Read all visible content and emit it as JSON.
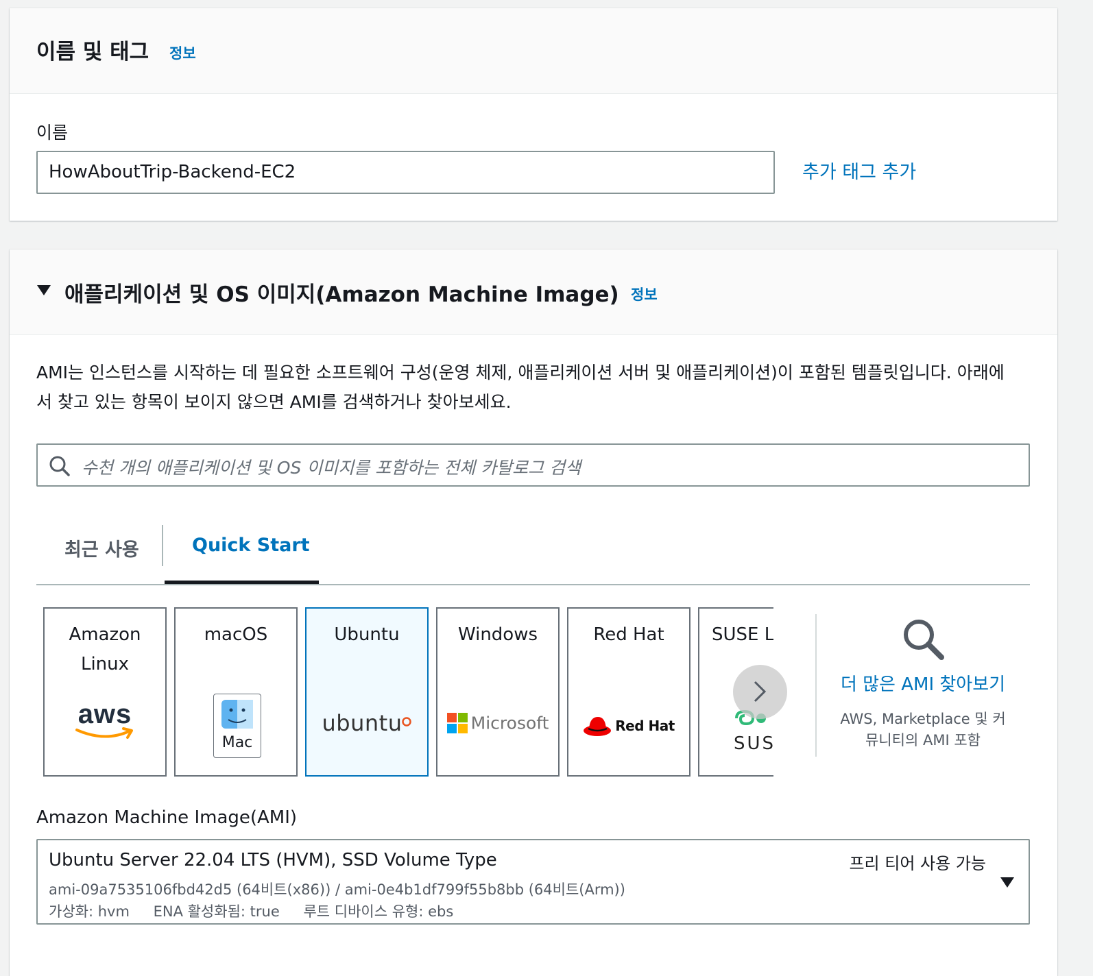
{
  "name_panel": {
    "title": "이름 및 태그",
    "info": "정보",
    "name_label": "이름",
    "name_value": "HowAboutTrip-Backend-EC2",
    "add_tags": "추가 태그 추가"
  },
  "ami_panel": {
    "title": "애플리케이션 및 OS 이미지(Amazon Machine Image)",
    "info": "정보",
    "description_line1": "AMI는 인스턴스를 시작하는 데 필요한 소프트웨어 구성(운영 체제, 애플리케이션 서버 및 애플리케이션)이 포함된 템플릿입니다. 아래에",
    "description_line2": "서 찾고 있는 항목이 보이지 않으면 AMI를 검색하거나 찾아보세요.",
    "search_placeholder": "수천 개의 애플리케이션 및 OS 이미지를 포함하는 전체 카탈로그 검색",
    "tabs": [
      {
        "label": "최근 사용",
        "active": false
      },
      {
        "label": "Quick Start",
        "active": true
      }
    ],
    "os_tiles": [
      {
        "title_line1": "Amazon",
        "title_line2": "Linux",
        "logo_text": "aws",
        "logo_icon": "aws-logo-icon",
        "selected": false
      },
      {
        "title_line1": "macOS",
        "title_line2": "",
        "logo_text": "Mac",
        "logo_icon": "mac-finder-icon",
        "selected": false
      },
      {
        "title_line1": "Ubuntu",
        "title_line2": "",
        "logo_text": "ubuntu",
        "logo_icon": "ubuntu-logo-icon",
        "selected": true
      },
      {
        "title_line1": "Windows",
        "title_line2": "",
        "logo_text": "Microsoft",
        "logo_icon": "microsoft-logo-icon",
        "selected": false
      },
      {
        "title_line1": "Red Hat",
        "title_line2": "",
        "logo_text": "Red Hat",
        "logo_icon": "redhat-logo-icon",
        "selected": false
      },
      {
        "title_line1": "SUSE Li",
        "title_line2": "",
        "logo_text": "SUS",
        "logo_icon": "suse-logo-icon",
        "selected": false
      }
    ],
    "browse_more_label": "더 많은 AMI 찾아보기",
    "browse_more_sub_line1": "AWS, Marketplace 및 커",
    "browse_more_sub_line2": "뮤니티의 AMI 포함",
    "ami_label": "Amazon Machine Image(AMI)",
    "selected_ami": {
      "name": "Ubuntu Server 22.04 LTS (HVM), SSD Volume Type",
      "ids": "ami-09a7535106fbd42d5 (64비트(x86)) / ami-0e4b1df799f55b8bb (64비트(Arm))",
      "virtualization": "가상화: hvm",
      "ena": "ENA 활성화됨: true",
      "root_device": "루트 디바이스 유형: ebs",
      "free_tier": "프리 티어 사용 가능"
    }
  },
  "colors": {
    "link": "#0073bb",
    "selected_tile_bg": "#f1faff",
    "redhat_red": "#ee0000",
    "ubuntu_orange": "#e95420",
    "aws_orange": "#ff9900"
  }
}
